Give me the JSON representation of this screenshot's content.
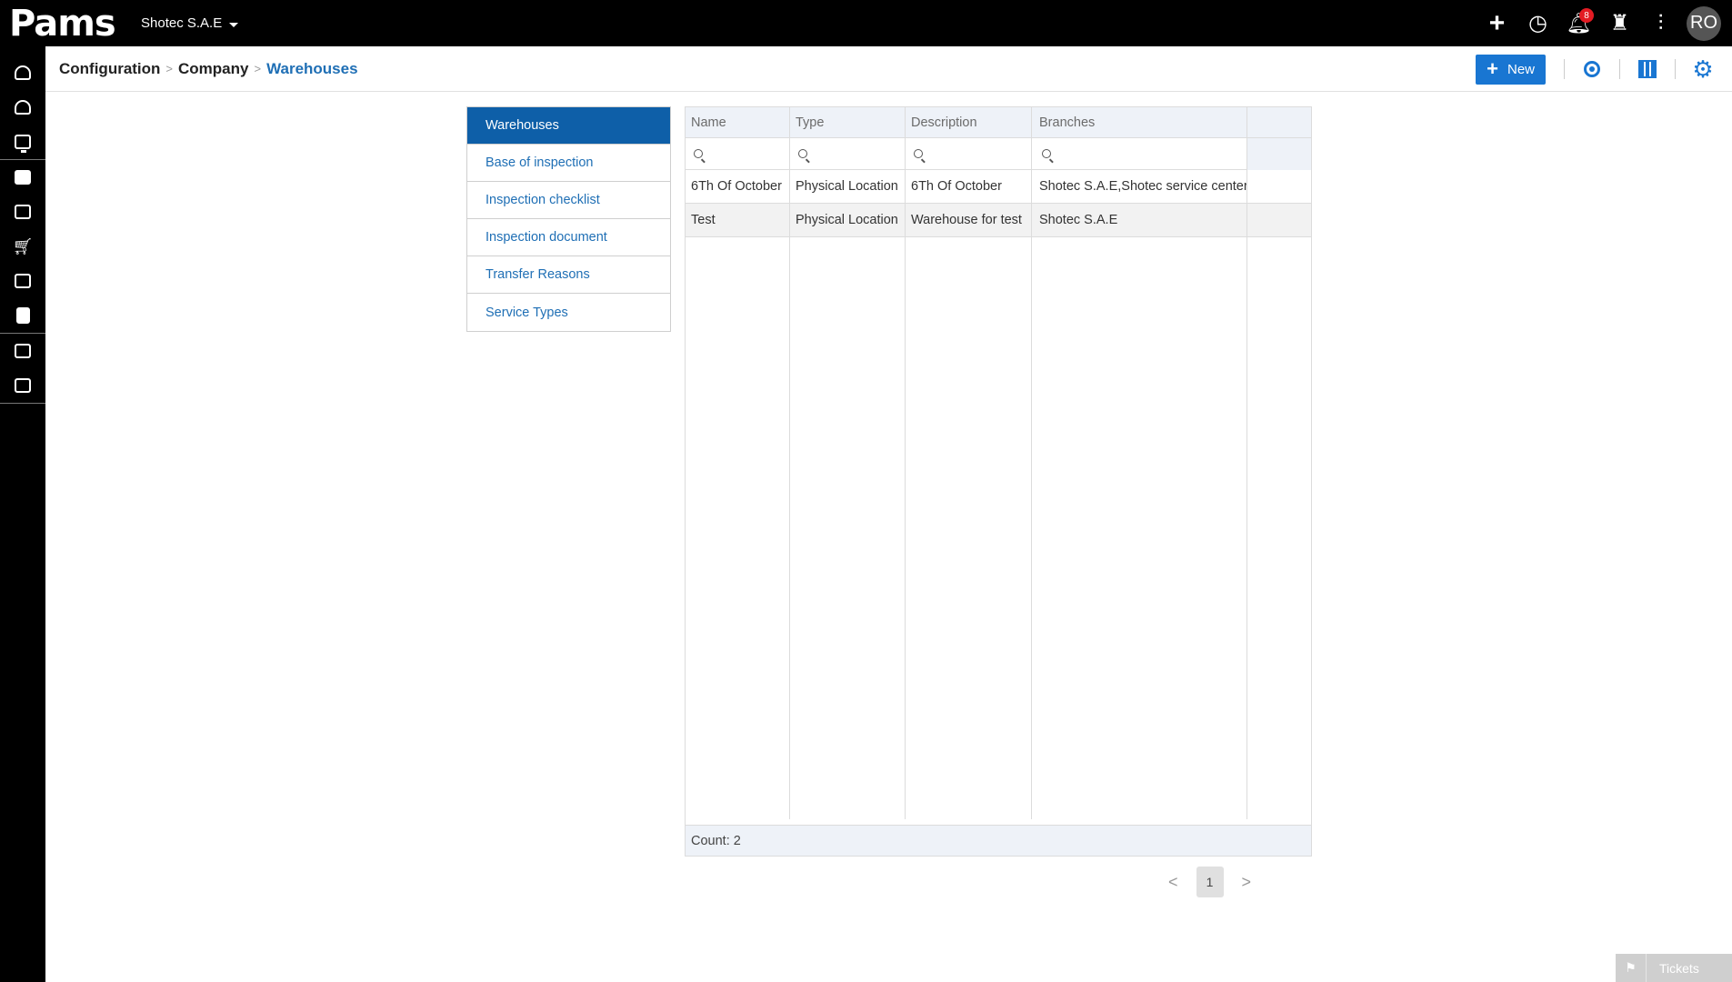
{
  "app": {
    "logo_text": "Pams",
    "company": "Shotec S.A.E",
    "notifications_count": "8",
    "user_initials": "RO"
  },
  "top_icons": [
    "plus-icon",
    "history-icon",
    "bell-icon",
    "castle-icon",
    "sliders-icon"
  ],
  "sidebar": {
    "items": [
      "dashboard-icon",
      "gauge-icon",
      "monitor-icon",
      "briefcase-icon",
      "modules-icon",
      "cart-icon",
      "modules-icon-2",
      "invoice-icon",
      "checklist-icon",
      "document-settings-icon",
      "grid-icon"
    ]
  },
  "breadcrumb": {
    "items": [
      "Configuration",
      "Company",
      "Warehouses"
    ]
  },
  "header": {
    "new_label": "New",
    "icons": [
      "refresh-icon",
      "columns-icon",
      "gear-icon"
    ]
  },
  "menu": {
    "items": [
      "Warehouses",
      "Base of inspection",
      "Inspection checklist",
      "Inspection document",
      "Transfer Reasons",
      "Service Types"
    ],
    "active_index": 0
  },
  "table": {
    "columns": [
      "Name",
      "Type",
      "Description",
      "Branches"
    ],
    "rows": [
      [
        "6Th Of October",
        "Physical Location",
        "6Th Of October",
        "Shotec S.A.E,Shotec service center"
      ],
      [
        "Test",
        "Physical Location",
        "Warehouse for test",
        "Shotec S.A.E"
      ]
    ],
    "count_label": "Count: 2"
  },
  "pager": {
    "current_page": "1"
  },
  "tickets": {
    "label": "Tickets"
  },
  "colors": {
    "accent": "#1976d2",
    "menu_active": "#0e5fa8",
    "link": "#1f6fb5",
    "topbar": "#000000"
  }
}
